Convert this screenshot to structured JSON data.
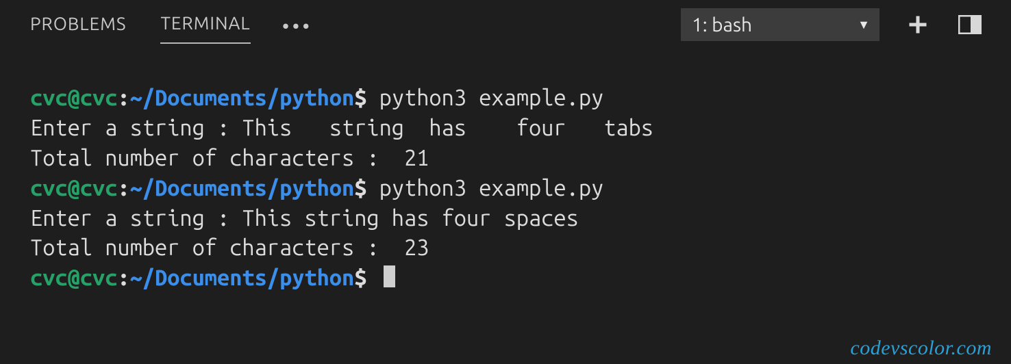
{
  "header": {
    "tabs": [
      {
        "label": "PROBLEMS",
        "active": false
      },
      {
        "label": "TERMINAL",
        "active": true
      }
    ],
    "overflow": "•••",
    "shell_selector": "1: bash"
  },
  "prompt": {
    "user_host": "cvc@cvc",
    "colon": ":",
    "path": "~/Documents/python",
    "symbol": "$"
  },
  "session": [
    {
      "type": "cmd",
      "text": "python3 example.py"
    },
    {
      "type": "out",
      "text": "Enter a string : This   string  has    four   tabs"
    },
    {
      "type": "out",
      "text": "Total number of characters :  21"
    },
    {
      "type": "cmd",
      "text": "python3 example.py"
    },
    {
      "type": "out",
      "text": "Enter a string : This string has four spaces"
    },
    {
      "type": "out",
      "text": "Total number of characters :  23"
    },
    {
      "type": "cmd",
      "text": "",
      "cursor": true
    }
  ],
  "watermark": "codevscolor.com"
}
